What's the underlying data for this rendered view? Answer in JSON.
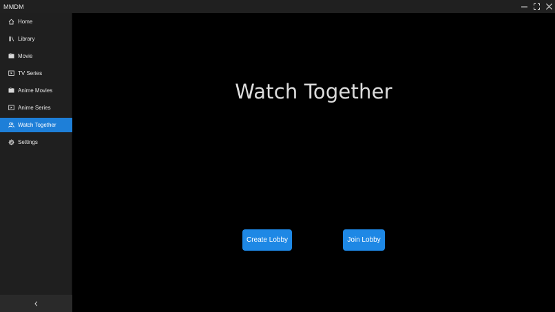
{
  "window": {
    "title": "MMDM",
    "controls": [
      "minimize-icon",
      "maximize-icon",
      "close-icon"
    ]
  },
  "sidebar": {
    "items": [
      {
        "label": "Home",
        "icon": "home-icon",
        "active": false
      },
      {
        "label": "Library",
        "icon": "library-icon",
        "active": false
      },
      {
        "label": "Movie",
        "icon": "movie-icon",
        "active": false
      },
      {
        "label": "TV Series",
        "icon": "tv-series-icon",
        "active": false
      },
      {
        "label": "Anime Movies",
        "icon": "movie-icon",
        "active": false
      },
      {
        "label": "Anime Series",
        "icon": "tv-series-icon",
        "active": false
      },
      {
        "label": "Watch Together",
        "icon": "people-icon",
        "active": true
      },
      {
        "label": "Settings",
        "icon": "gear-icon",
        "active": false
      }
    ],
    "collapse_icon": "chevron-left-icon"
  },
  "main": {
    "title": "Watch Together",
    "create_label": "Create Lobby",
    "join_label": "Join Lobby"
  },
  "colors": {
    "accent": "#1e88e5",
    "sidebar_active": "#1e7fd8",
    "sidebar_bg": "#1f1f1f",
    "main_bg": "#000000",
    "titlebar_bg": "#202020"
  }
}
